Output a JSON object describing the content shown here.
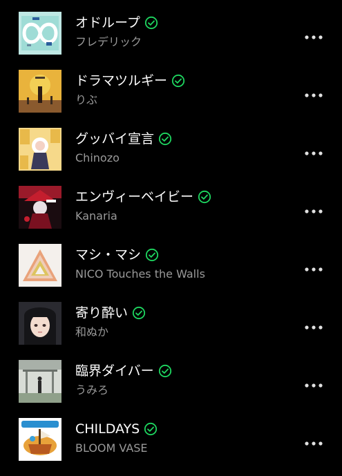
{
  "tracks": [
    {
      "title": "オドループ",
      "artist": "フレデリック",
      "art_icon": "album-art-odoloop"
    },
    {
      "title": "ドラマツルギー",
      "artist": "りぶ",
      "art_icon": "album-art-dramaturgy"
    },
    {
      "title": "グッバイ宣言",
      "artist": "Chinozo",
      "art_icon": "album-art-goodbye-sengen"
    },
    {
      "title": "エンヴィーベイビー",
      "artist": "Kanaria",
      "art_icon": "album-art-envy-baby"
    },
    {
      "title": "マシ・マシ",
      "artist": "NICO Touches the Walls",
      "art_icon": "album-art-mashi-mashi"
    },
    {
      "title": "寄り酔い",
      "artist": "和ぬか",
      "art_icon": "album-art-yoriyoi"
    },
    {
      "title": "臨界ダイバー",
      "artist": "うみろ",
      "art_icon": "album-art-rinkai-diver"
    },
    {
      "title": "CHILDAYS",
      "artist": "BLOOM VASE",
      "art_icon": "album-art-childays"
    }
  ],
  "icons": {
    "downloaded": "check-circle-icon",
    "more": "more-options-icon"
  },
  "colors": {
    "background": "#000000",
    "title": "#ffffff",
    "artist": "#9a9a9a",
    "downloaded_accent": "#1ed760"
  }
}
